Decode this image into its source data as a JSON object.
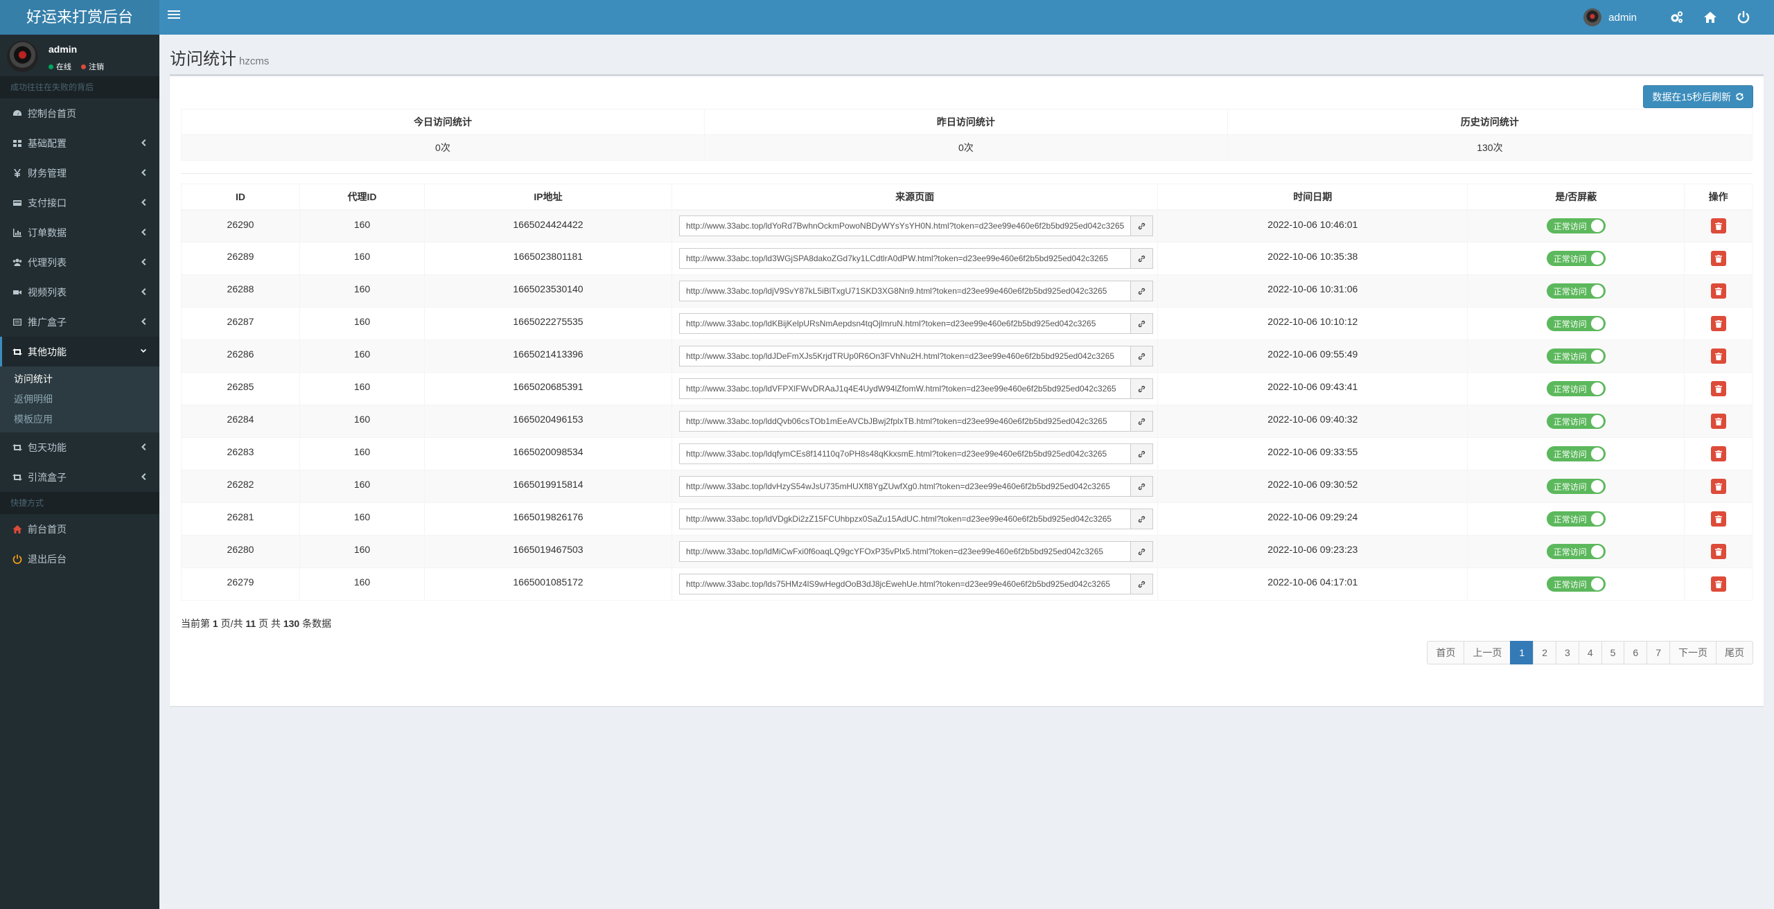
{
  "app": {
    "title": "好运来打赏后台"
  },
  "header": {
    "user_name": "admin"
  },
  "sidebar": {
    "user": {
      "name": "admin",
      "status_online": "在线",
      "status_logout": "注销"
    },
    "section_main": "成功往往在失败的背后",
    "items": [
      {
        "label": "控制台首页",
        "icon": "dashboard-icon"
      },
      {
        "label": "基础配置",
        "icon": "grid-icon"
      },
      {
        "label": "财务管理",
        "icon": "yen-icon"
      },
      {
        "label": "支付接口",
        "icon": "card-icon"
      },
      {
        "label": "订单数据",
        "icon": "chart-icon"
      },
      {
        "label": "代理列表",
        "icon": "users-icon"
      },
      {
        "label": "视频列表",
        "icon": "video-icon"
      },
      {
        "label": "推广盒子",
        "icon": "box-icon"
      },
      {
        "label": "其他功能",
        "icon": "retweet-icon"
      }
    ],
    "sub_items": [
      "访问统计",
      "返佣明细",
      "模板应用"
    ],
    "items2": [
      {
        "label": "包天功能",
        "icon": "retweet-icon"
      },
      {
        "label": "引流盒子",
        "icon": "retweet-icon"
      }
    ],
    "section_quick": "快捷方式",
    "quick": [
      {
        "label": "前台首页",
        "icon": "home-icon"
      },
      {
        "label": "退出后台",
        "icon": "power-icon"
      }
    ]
  },
  "page": {
    "title": "访问统计",
    "subtitle": "hzcms",
    "refresh_label": "数据在15秒后刷新"
  },
  "stats": {
    "headers": [
      "今日访问统计",
      "昨日访问统计",
      "历史访问统计"
    ],
    "values": [
      "0次",
      "0次",
      "130次"
    ]
  },
  "table": {
    "headers": [
      "ID",
      "代理ID",
      "IP地址",
      "来源页面",
      "时间日期",
      "是/否屏蔽",
      "操作"
    ],
    "toggle_label": "正常访问",
    "rows": [
      {
        "id": "26290",
        "agent": "160",
        "ip": "1665024424422",
        "url": "http://www.33abc.top/ldYoRd7BwhnOckmPowoNBDyWYsYsYH0N.html?token=d23ee99e460e6f2b5bd925ed042c3265",
        "time": "2022-10-06 10:46:01"
      },
      {
        "id": "26289",
        "agent": "160",
        "ip": "1665023801181",
        "url": "http://www.33abc.top/ld3WGjSPA8dakoZGd7ky1LCdtlrA0dPW.html?token=d23ee99e460e6f2b5bd925ed042c3265",
        "time": "2022-10-06 10:35:38"
      },
      {
        "id": "26288",
        "agent": "160",
        "ip": "1665023530140",
        "url": "http://www.33abc.top/ldjV9SvY87kL5iBlTxgU71SKD3XG8Nn9.html?token=d23ee99e460e6f2b5bd925ed042c3265",
        "time": "2022-10-06 10:31:06"
      },
      {
        "id": "26287",
        "agent": "160",
        "ip": "1665022275535",
        "url": "http://www.33abc.top/ldKBijKelpURsNmAepdsn4tqOjlmruN.html?token=d23ee99e460e6f2b5bd925ed042c3265",
        "time": "2022-10-06 10:10:12"
      },
      {
        "id": "26286",
        "agent": "160",
        "ip": "1665021413396",
        "url": "http://www.33abc.top/ldJDeFmXJs5KrjdTRUp0R6On3FVhNu2H.html?token=d23ee99e460e6f2b5bd925ed042c3265",
        "time": "2022-10-06 09:55:49"
      },
      {
        "id": "26285",
        "agent": "160",
        "ip": "1665020685391",
        "url": "http://www.33abc.top/ldVFPXlFWvDRAaJ1q4E4UydW94lZfomW.html?token=d23ee99e460e6f2b5bd925ed042c3265",
        "time": "2022-10-06 09:43:41"
      },
      {
        "id": "26284",
        "agent": "160",
        "ip": "1665020496153",
        "url": "http://www.33abc.top/lddQvb06csTOb1mEeAVCbJBwj2fplxTB.html?token=d23ee99e460e6f2b5bd925ed042c3265",
        "time": "2022-10-06 09:40:32"
      },
      {
        "id": "26283",
        "agent": "160",
        "ip": "1665020098534",
        "url": "http://www.33abc.top/ldqfymCEs8f14110q7oPH8s48qKkxsmE.html?token=d23ee99e460e6f2b5bd925ed042c3265",
        "time": "2022-10-06 09:33:55"
      },
      {
        "id": "26282",
        "agent": "160",
        "ip": "1665019915814",
        "url": "http://www.33abc.top/ldvHzyS54wJsU735mHUXfl8YgZUwfXg0.html?token=d23ee99e460e6f2b5bd925ed042c3265",
        "time": "2022-10-06 09:30:52"
      },
      {
        "id": "26281",
        "agent": "160",
        "ip": "1665019826176",
        "url": "http://www.33abc.top/ldVDgkDi2zZ15FCUhbpzx0SaZu15AdUC.html?token=d23ee99e460e6f2b5bd925ed042c3265",
        "time": "2022-10-06 09:29:24"
      },
      {
        "id": "26280",
        "agent": "160",
        "ip": "1665019467503",
        "url": "http://www.33abc.top/ldMiCwFxi0f6oaqLQ9gcYFOxP35vPlx5.html?token=d23ee99e460e6f2b5bd925ed042c3265",
        "time": "2022-10-06 09:23:23"
      },
      {
        "id": "26279",
        "agent": "160",
        "ip": "1665001085172",
        "url": "http://www.33abc.top/lds75HMz4lS9wHegdOoB3dJ8jcEwehUe.html?token=d23ee99e460e6f2b5bd925ed042c3265",
        "time": "2022-10-06 04:17:01"
      }
    ]
  },
  "pager": {
    "p1": "当前第",
    "page": "1",
    "p2": "页/共",
    "pages": "11",
    "p3": "页 共",
    "total": "130",
    "p4": "条数据",
    "buttons": [
      "首页",
      "上一页",
      "1",
      "2",
      "3",
      "4",
      "5",
      "6",
      "7",
      "下一页",
      "尾页"
    ],
    "active_index": 2
  }
}
